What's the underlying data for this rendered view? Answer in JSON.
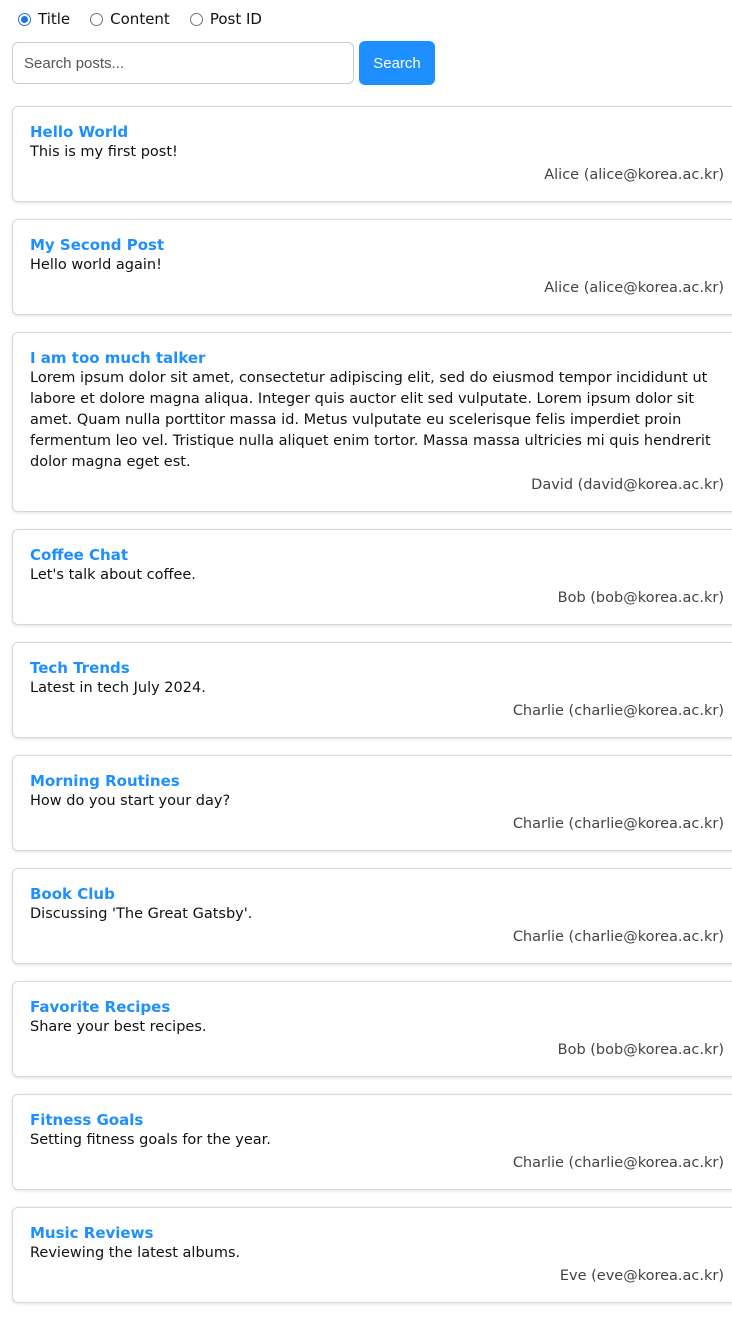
{
  "search_mode": {
    "options": [
      {
        "label": "Title",
        "checked": true
      },
      {
        "label": "Content",
        "checked": false
      },
      {
        "label": "Post ID",
        "checked": false
      }
    ]
  },
  "search": {
    "placeholder": "Search posts...",
    "value": "",
    "button_label": "Search"
  },
  "colors": {
    "accent": "#1e8fff",
    "title_link": "#1e8fff"
  },
  "posts": [
    {
      "title": "Hello World",
      "content": "This is my first post!",
      "author": "Alice (alice@korea.ac.kr)"
    },
    {
      "title": "My Second Post",
      "content": "Hello world again!",
      "author": "Alice (alice@korea.ac.kr)"
    },
    {
      "title": "I am too much talker",
      "content": "Lorem ipsum dolor sit amet, consectetur adipiscing elit, sed do eiusmod tempor incididunt ut labore et dolore magna aliqua. Integer quis auctor elit sed vulputate. Lorem ipsum dolor sit amet. Quam nulla porttitor massa id. Metus vulputate eu scelerisque felis imperdiet proin fermentum leo vel. Tristique nulla aliquet enim tortor. Massa massa ultricies mi quis hendrerit dolor magna eget est.",
      "author": "David (david@korea.ac.kr)"
    },
    {
      "title": "Coffee Chat",
      "content": "Let's talk about coffee.",
      "author": "Bob (bob@korea.ac.kr)"
    },
    {
      "title": "Tech Trends",
      "content": "Latest in tech July 2024.",
      "author": "Charlie (charlie@korea.ac.kr)"
    },
    {
      "title": "Morning Routines",
      "content": "How do you start your day?",
      "author": "Charlie (charlie@korea.ac.kr)"
    },
    {
      "title": "Book Club",
      "content": "Discussing 'The Great Gatsby'.",
      "author": "Charlie (charlie@korea.ac.kr)"
    },
    {
      "title": "Favorite Recipes",
      "content": "Share your best recipes.",
      "author": "Bob (bob@korea.ac.kr)"
    },
    {
      "title": "Fitness Goals",
      "content": "Setting fitness goals for the year.",
      "author": "Charlie (charlie@korea.ac.kr)"
    },
    {
      "title": "Music Reviews",
      "content": "Reviewing the latest albums.",
      "author": "Eve (eve@korea.ac.kr)"
    }
  ]
}
